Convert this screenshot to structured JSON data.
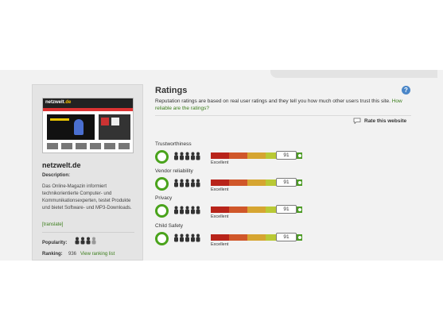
{
  "site": {
    "name": "netzwelt.de",
    "thumbnail_logo_prefix": "",
    "thumbnail_logo": "netzwelt",
    "thumbnail_logo_suffix": ".de"
  },
  "description": {
    "heading": "Description:",
    "text": "Das Online-Magazin informiert technikorientierte Computer- und Kommunikationsexperten, testet Produkte und bietet Software- und MP3-Downloads.",
    "translate_link": "[translate]"
  },
  "stats": {
    "popularity_label": "Popularity:",
    "ranking_label": "Ranking:",
    "ranking_value": "936",
    "ranking_link": "View ranking list"
  },
  "ratings": {
    "title": "Ratings",
    "description": "Reputation ratings are based on real user ratings and they tell you how much other users trust this site.",
    "description_link": "How reliable are the ratings?",
    "rate_button": "Rate this website",
    "items": [
      {
        "label": "Trustworthiness",
        "score": "91",
        "level": "Excellent"
      },
      {
        "label": "Vendor reliability",
        "score": "91",
        "level": "Excellent"
      },
      {
        "label": "Privacy",
        "score": "91",
        "level": "Excellent"
      },
      {
        "label": "Child Safety",
        "score": "91",
        "level": "Excellent"
      }
    ]
  },
  "icons": {
    "help": "help-icon",
    "rate": "speech-bubble-icon",
    "confidence": "people-icon",
    "reputation": "ring-icon"
  },
  "colors": {
    "link_green": "#3a7d1a",
    "ring_green": "#4aa31c",
    "bar": [
      "#b8241a",
      "#d0572a",
      "#d6a531",
      "#b9c935",
      "#4d9b26"
    ],
    "help_blue": "#4a86c8"
  }
}
